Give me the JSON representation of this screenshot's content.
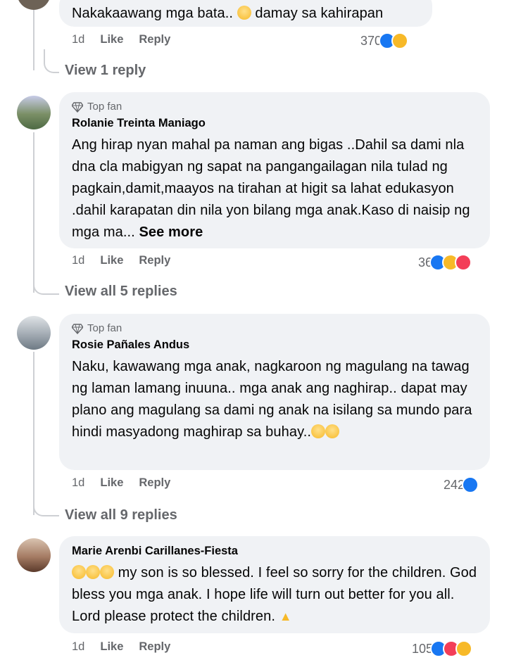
{
  "comments": [
    {
      "text": "Nakakaawang mga bata.. ",
      "text2": "damay sa kahirapan",
      "time": "1d",
      "like": "Like",
      "reply": "Reply",
      "reaction_count": "370",
      "view_replies": "View 1 reply"
    },
    {
      "badge": "Top fan",
      "author": "Rolanie Treinta Maniago",
      "text": "Ang hirap nyan mahal pa naman ang bigas ..Dahil sa dami nla dna cla mabigyan ng sapat na pangangailagan nila tulad ng pagkain,damit,maayos na tirahan at higit sa lahat edukasyon .dahil karapatan din nila yon bilang mga anak.Kaso di naisip ng mga ma... ",
      "see_more": "See more",
      "time": "1d",
      "like": "Like",
      "reply": "Reply",
      "reaction_count": "36",
      "view_replies": "View all 5 replies"
    },
    {
      "badge": "Top fan",
      "author": "Rosie Pañales Andus",
      "text": "Naku, kawawang mga anak, nagkaroon ng magulang na tawag ng laman lamang inuuna.. mga anak ang naghirap.. dapat may plano ang magulang sa dami ng anak na isilang sa mundo para hindi masyadong maghirap sa buhay..",
      "time": "1d",
      "like": "Like",
      "reply": "Reply",
      "reaction_count": "242",
      "view_replies": "View all 9 replies"
    },
    {
      "author": "Marie Arenbi Carillanes-Fiesta",
      "text": " my son is so blessed. I feel so sorry for the children. God bless you mga anak. I hope life will turn out better for you all. Lord please protect the children. ",
      "time": "1d",
      "like": "Like",
      "reply": "Reply",
      "reaction_count": "105"
    }
  ],
  "colors": {
    "like": "#1877f2",
    "love": "#f33e58",
    "sad": "#f7b928",
    "bubble": "#f0f2f5",
    "muted": "#65676b"
  },
  "icons": [
    "diamond-icon",
    "like-reaction-icon",
    "sad-reaction-icon",
    "love-reaction-icon",
    "care-reaction-icon",
    "crying-emoji",
    "praying-hands-emoji"
  ]
}
